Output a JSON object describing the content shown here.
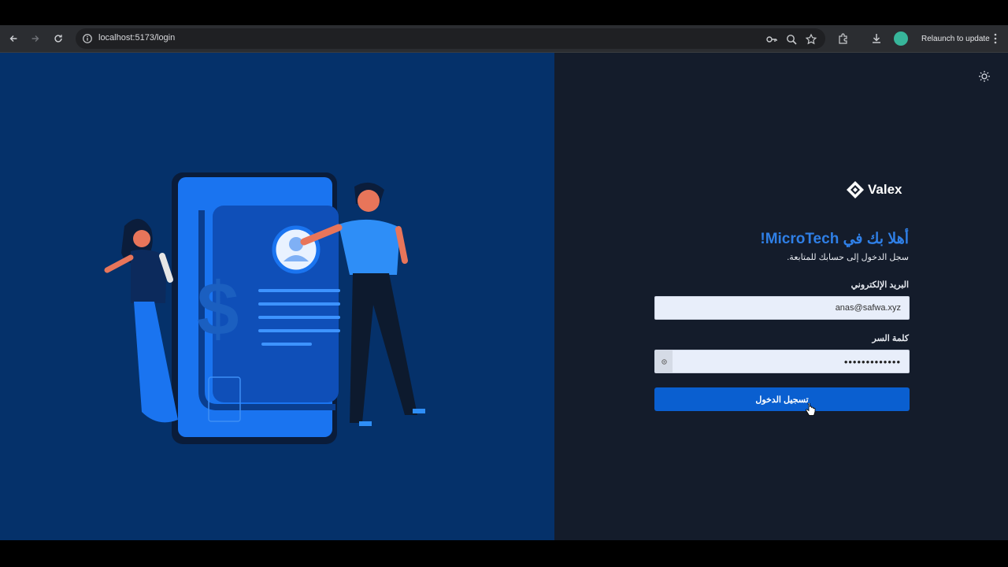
{
  "browser": {
    "url": "localhost:5173/login",
    "relaunch_label": "Relaunch to update"
  },
  "brand": {
    "name": "Valex"
  },
  "login": {
    "welcome": "أهلا بك في MicroTech!",
    "subtitle": "سجل الدخول إلى حسابك للمتابعة.",
    "email_label": "البريد الإلكتروني",
    "email_value": "anas@safwa.xyz",
    "password_label": "كلمة السر",
    "password_masked": "•••••••••••••",
    "submit_label": "تسجيل الدخول"
  },
  "colors": {
    "left_panel": "#05316a",
    "right_panel": "#141c2b",
    "accent": "#2f7fe6",
    "button": "#0a5fd0"
  }
}
